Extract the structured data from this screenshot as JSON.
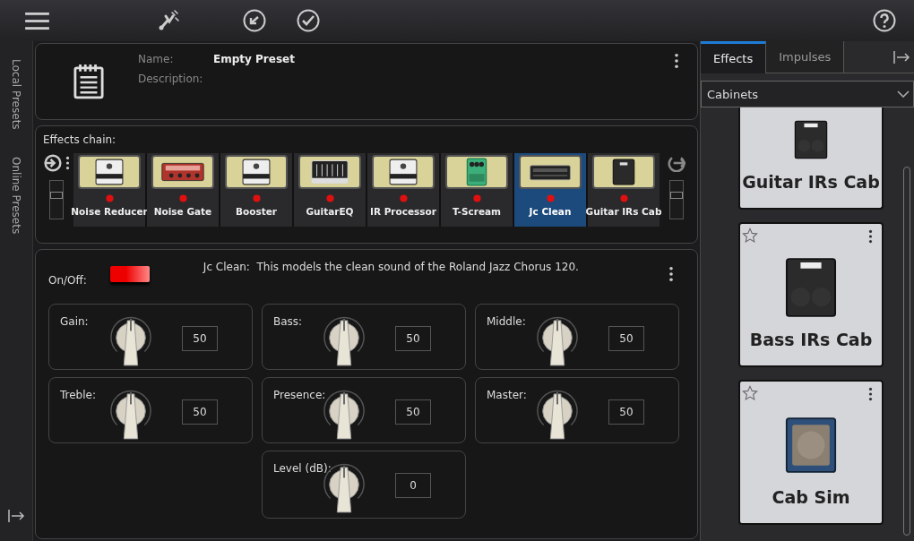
{
  "preset": {
    "name_label": "Name:",
    "name": "Empty Preset",
    "description_label": "Description:"
  },
  "side_tabs": [
    "Local Presets",
    "Online Presets"
  ],
  "chain": {
    "title": "Effects chain:",
    "items": [
      {
        "name": "Noise Reducer",
        "kind": "pedal",
        "selected": false
      },
      {
        "name": "Noise Gate",
        "kind": "rack",
        "selected": false
      },
      {
        "name": "Booster",
        "kind": "pedal",
        "selected": false
      },
      {
        "name": "GuitarEQ",
        "kind": "eq",
        "selected": false
      },
      {
        "name": "IR Processor",
        "kind": "pedal",
        "selected": false
      },
      {
        "name": "T-Scream",
        "kind": "green",
        "selected": false
      },
      {
        "name": "Jc Clean",
        "kind": "amp",
        "selected": true
      },
      {
        "name": "Guitar IRs Cab",
        "kind": "cabinet",
        "selected": false
      }
    ]
  },
  "effect": {
    "onoff_label": "On/Off:",
    "on": true,
    "description": "Jc Clean:  This models the clean sound of the Roland Jazz Chorus 120.",
    "params": [
      {
        "label": "Gain:",
        "value": "50"
      },
      {
        "label": "Bass:",
        "value": "50"
      },
      {
        "label": "Middle:",
        "value": "50"
      },
      {
        "label": "Treble:",
        "value": "50"
      },
      {
        "label": "Presence:",
        "value": "50"
      },
      {
        "label": "Master:",
        "value": "50"
      },
      {
        "label": "Level (dB):",
        "value": "0"
      }
    ]
  },
  "library": {
    "tabs": [
      {
        "label": "Effects",
        "selected": true
      },
      {
        "label": "Impulses",
        "selected": false
      }
    ],
    "category": "Cabinets",
    "cards": [
      {
        "name": "Guitar IRs Cab",
        "kind": "cabinet",
        "cut": true
      },
      {
        "name": "Bass IRs Cab",
        "kind": "cabinet",
        "cut": false
      },
      {
        "name": "Cab Sim",
        "kind": "combo",
        "cut": false
      }
    ]
  }
}
